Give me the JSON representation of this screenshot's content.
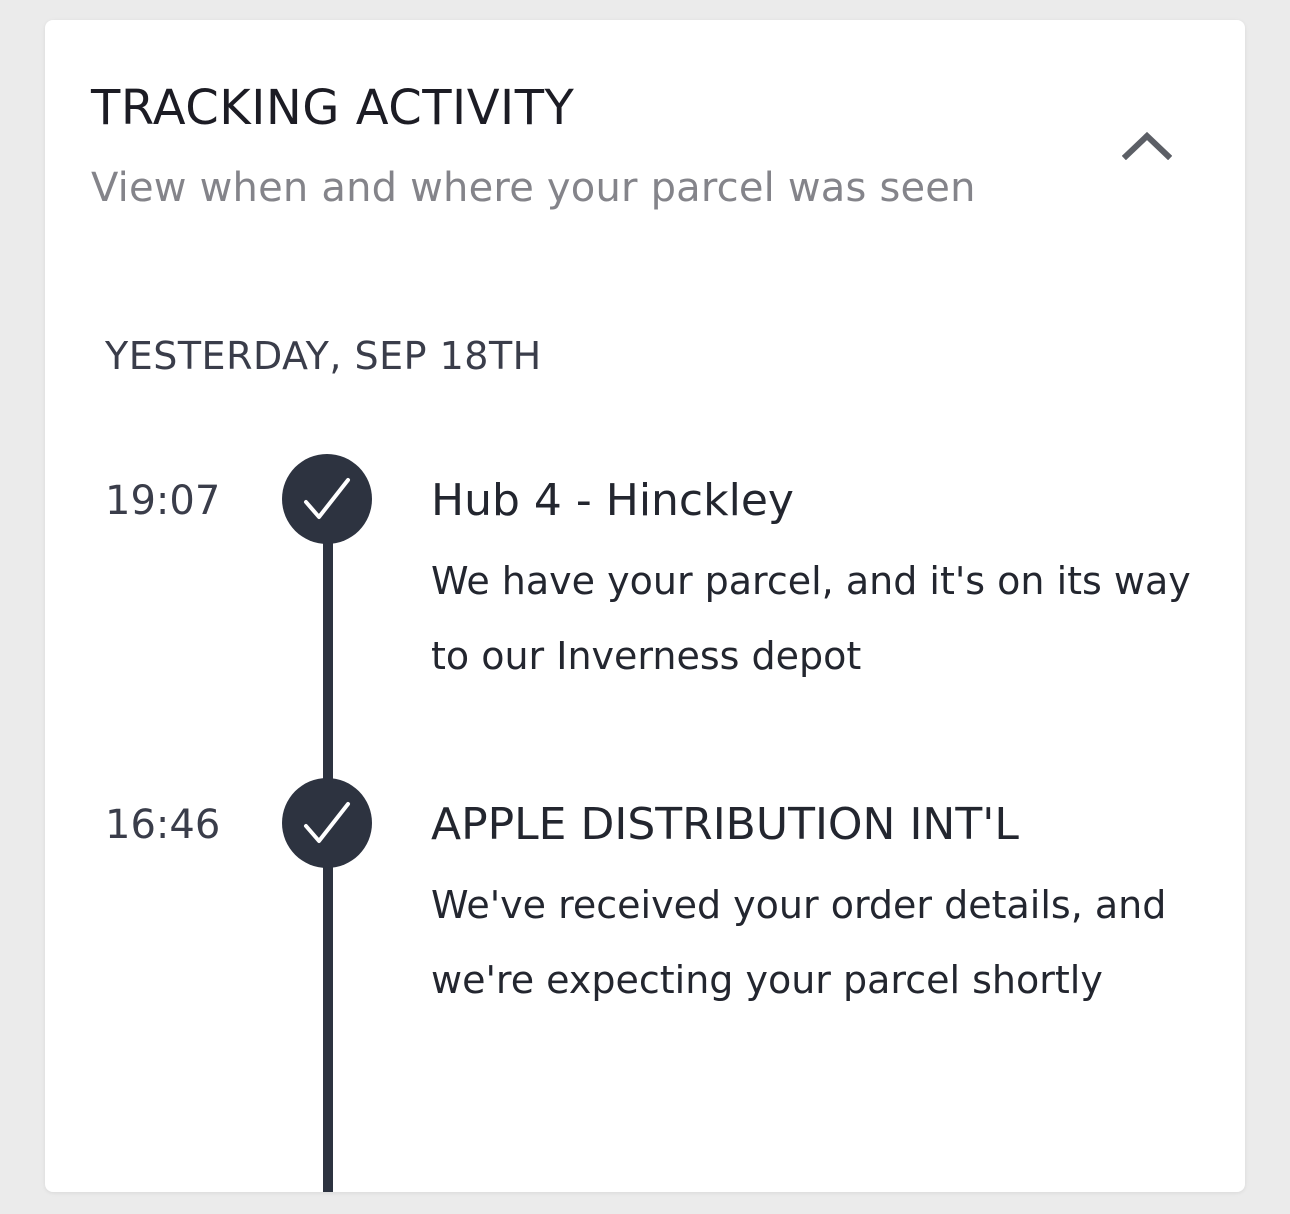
{
  "tracking": {
    "title": "TRACKING ACTIVITY",
    "subtitle": "View when and where your parcel was seen",
    "collapse_icon": "chevron-up-icon",
    "date_heading": "YESTERDAY, SEP 18TH",
    "events": [
      {
        "time": "19:07",
        "status_icon": "check-icon",
        "location": "Hub 4 - Hinckley",
        "description": "We have your parcel, and it's on its way to our Inverness depot"
      },
      {
        "time": "16:46",
        "status_icon": "check-icon",
        "location": "APPLE DISTRIBUTION INT'L",
        "description": "We've received your order details, and we're expecting your parcel shortly"
      }
    ]
  },
  "colors": {
    "background": "#ebebeb",
    "card": "#ffffff",
    "timeline": "#2d3340",
    "title_text": "#1c1c24",
    "subtitle_text": "#84848a"
  }
}
